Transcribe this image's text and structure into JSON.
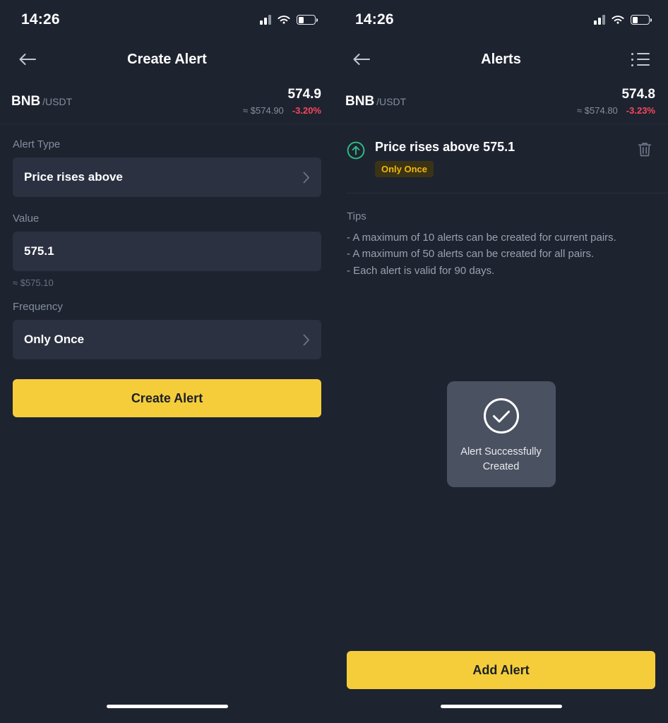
{
  "status_bar": {
    "time": "14:26",
    "signal_icon": "signal-bars-icon",
    "wifi_icon": "wifi-icon",
    "battery_icon": "battery-icon"
  },
  "colors": {
    "page_bg": "#1e2330",
    "field_bg": "#2b3141",
    "accent_yellow": "#f5cd3b",
    "badge_yellow": "#f0b90b",
    "badge_bg": "#3b3316",
    "up_green": "#2ebd85",
    "down_red": "#f6465d",
    "muted_text": "#848e9c",
    "toast_bg": "#4a5160"
  },
  "left_screen": {
    "nav": {
      "back_icon": "arrow-left-icon",
      "title": "Create Alert"
    },
    "ticker": {
      "base": "BNB",
      "quote": "/USDT",
      "last_price": "574.9",
      "usd_value": "≈ $574.90",
      "change_pct": "-3.20%"
    },
    "form": {
      "alert_type_label": "Alert Type",
      "alert_type_value": "Price rises above",
      "value_label": "Value",
      "value_value": "575.1",
      "value_hint": "≈ $575.10",
      "frequency_label": "Frequency",
      "frequency_value": "Only Once",
      "submit_label": "Create Alert"
    }
  },
  "right_screen": {
    "nav": {
      "back_icon": "arrow-left-icon",
      "title": "Alerts",
      "list_icon": "list-icon"
    },
    "ticker": {
      "base": "BNB",
      "quote": "/USDT",
      "last_price": "574.8",
      "usd_value": "≈ $574.80",
      "change_pct": "-3.23%"
    },
    "alerts": [
      {
        "direction_icon": "arrow-up-circle-icon",
        "title": "Price rises above 575.1",
        "badge": "Only Once",
        "delete_icon": "trash-icon"
      }
    ],
    "tips": {
      "title": "Tips",
      "lines": [
        "- A maximum of 10 alerts can be created for current pairs.",
        "- A maximum of 50 alerts can be created for all pairs.",
        "- Each alert is valid for 90 days."
      ]
    },
    "toast": {
      "icon": "check-circle-icon",
      "message": "Alert Successfully Created"
    },
    "add_button_label": "Add Alert"
  }
}
